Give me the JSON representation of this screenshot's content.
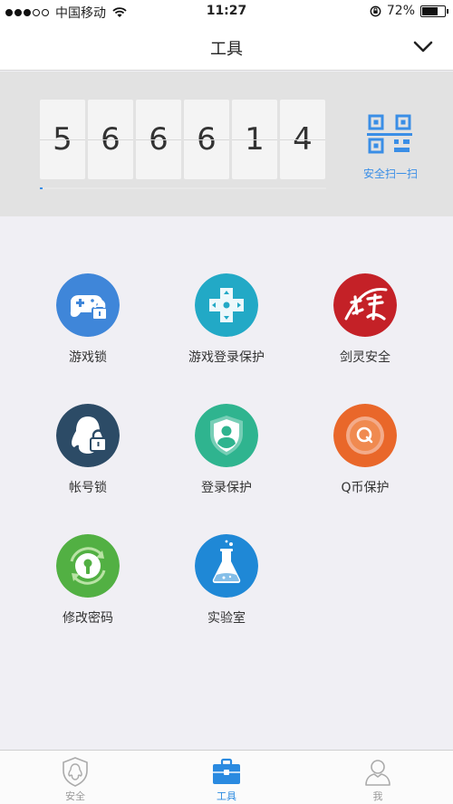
{
  "status_bar": {
    "carrier": "中国移动",
    "time": "11:27",
    "battery": "72%",
    "battery_level": 0.72
  },
  "nav": {
    "title": "工具"
  },
  "token": {
    "digits": [
      "5",
      "6",
      "6",
      "6",
      "1",
      "4"
    ],
    "progress": 0.01,
    "scan_label": "安全扫一扫"
  },
  "tools": [
    {
      "label": "游戏锁",
      "icon": "game-lock-icon",
      "color": "#3f86d9"
    },
    {
      "label": "游戏登录保护",
      "icon": "game-login-protect-icon",
      "color": "#22a9c6"
    },
    {
      "label": "剑灵安全",
      "icon": "jianling-logo-icon",
      "color": "#c42127"
    },
    {
      "label": "帐号锁",
      "icon": "account-lock-icon",
      "color": "#2c4b66"
    },
    {
      "label": "登录保护",
      "icon": "login-protect-icon",
      "color": "#2fb48f"
    },
    {
      "label": "Q币保护",
      "icon": "qcoin-protect-icon",
      "color": "#e9672a"
    },
    {
      "label": "修改密码",
      "icon": "change-password-icon",
      "color": "#52b043"
    },
    {
      "label": "实验室",
      "icon": "lab-icon",
      "color": "#1f88d6"
    }
  ],
  "tabs": [
    {
      "label": "安全",
      "icon": "shield-icon",
      "active": false
    },
    {
      "label": "工具",
      "icon": "toolbox-icon",
      "active": true
    },
    {
      "label": "我",
      "icon": "user-icon",
      "active": false
    }
  ],
  "colors": {
    "accent": "#3a8ee6"
  }
}
